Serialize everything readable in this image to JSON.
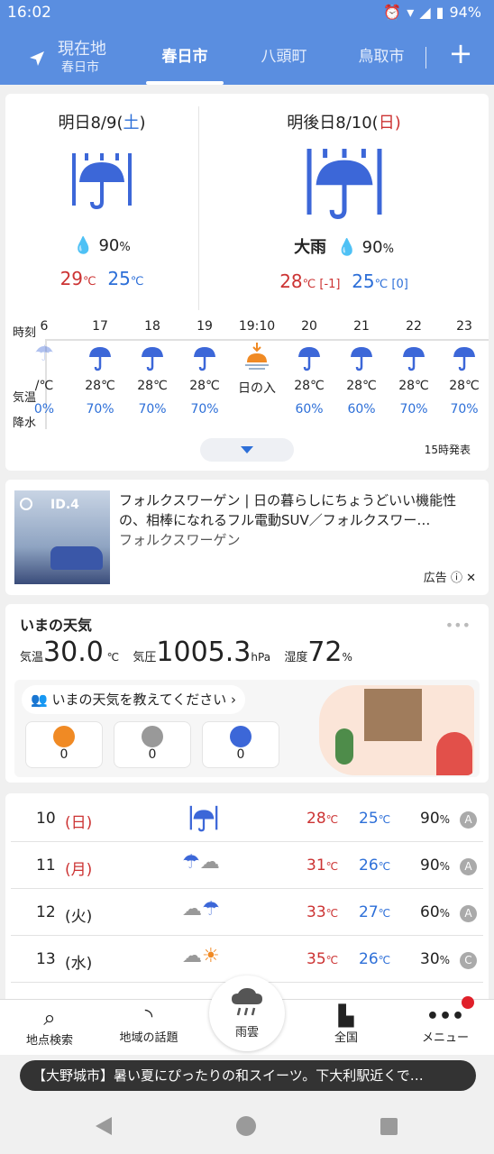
{
  "status": {
    "time": "16:02",
    "battery": "94%"
  },
  "tabs": {
    "current_label": "現在地",
    "current_sub": "春日市",
    "t1": "春日市",
    "t2": "八頭町",
    "t3": "鳥取市",
    "add": "+"
  },
  "tomorrow": {
    "label": "明日8/9(",
    "wd": "土",
    "close": ")",
    "precip": "90",
    "hi": "29",
    "lo": "25"
  },
  "dayafter": {
    "label": "明後日8/10(",
    "wd": "日",
    "close": ")",
    "weather": "大雨",
    "precip": "90",
    "hi": "28",
    "hi_diff": "[-1]",
    "lo": "25",
    "lo_diff": "[0]"
  },
  "hourly": {
    "row_labels": {
      "time": "時刻",
      "temp": "気温",
      "precip": "降水"
    },
    "cols": [
      {
        "t": "6",
        "temp": "/℃",
        "p": "0%"
      },
      {
        "t": "17",
        "temp": "28℃",
        "p": "70%"
      },
      {
        "t": "18",
        "temp": "28℃",
        "p": "70%"
      },
      {
        "t": "19",
        "temp": "28℃",
        "p": "70%"
      },
      {
        "t": "19:10",
        "temp": "日の入",
        "p": ""
      },
      {
        "t": "20",
        "temp": "28℃",
        "p": "60%"
      },
      {
        "t": "21",
        "temp": "28℃",
        "p": "60%"
      },
      {
        "t": "22",
        "temp": "28℃",
        "p": "70%"
      },
      {
        "t": "23",
        "temp": "28℃",
        "p": "70%"
      }
    ],
    "announce": "15時発表"
  },
  "ad": {
    "img_text": "ID.4",
    "text1": "フォルクスワーゲン | 日の暮らしにちょうどいい機能性",
    "text2": "の、相棒になれるフル電動SUV／フォルクスワー…",
    "sponsor": "フォルクスワーゲン",
    "label": "広告"
  },
  "now": {
    "title": "いまの天気",
    "temp_label": "気温",
    "temp": "30.0",
    "temp_unit": "℃",
    "press_label": "気圧",
    "press": "1005.3",
    "press_unit": "hPa",
    "hum_label": "湿度",
    "hum": "72",
    "hum_unit": "%",
    "prompt": "いまの天気を教えてください",
    "votes": [
      "0",
      "0",
      "0"
    ]
  },
  "forecast": [
    {
      "d": "10",
      "wd": "(日)",
      "hi": "28",
      "lo": "25",
      "p": "90",
      "g": "A",
      "wdc": "#cc3333"
    },
    {
      "d": "11",
      "wd": "(月)",
      "hi": "31",
      "lo": "26",
      "p": "90",
      "g": "A",
      "wdc": "#cc3333"
    },
    {
      "d": "12",
      "wd": "(火)",
      "hi": "33",
      "lo": "27",
      "p": "60",
      "g": "A",
      "wdc": "#222222"
    },
    {
      "d": "13",
      "wd": "(水)",
      "hi": "35",
      "lo": "26",
      "p": "30",
      "g": "C",
      "wdc": "#222222"
    }
  ],
  "nav": {
    "search": "地点検索",
    "topics": "地域の話題",
    "rain": "雨雲",
    "national": "全国",
    "menu": "メニュー"
  },
  "toast": "【大野城市】暑い夏にぴったりの和スイーツ。下大利駅近くで…"
}
